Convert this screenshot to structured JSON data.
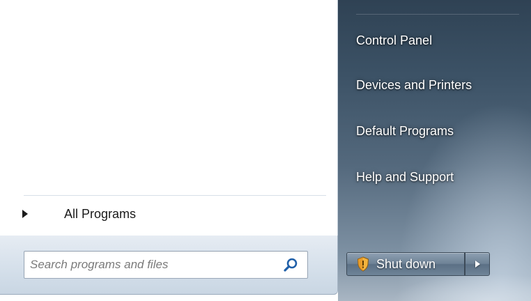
{
  "left_pane": {
    "all_programs_label": "All Programs",
    "search": {
      "placeholder": "Search programs and files",
      "value": ""
    },
    "icons": {
      "arrow": "arrow-right-icon",
      "search": "search-icon"
    }
  },
  "right_pane": {
    "items": [
      {
        "label": "Control Panel"
      },
      {
        "label": "Devices and Printers"
      },
      {
        "label": "Default Programs"
      },
      {
        "label": "Help and Support"
      }
    ],
    "shutdown": {
      "label": "Shut down",
      "icon": "shield-icon",
      "arrow_icon": "chevron-right-icon"
    }
  },
  "colors": {
    "accent_dark": "#2f4254",
    "accent_light": "#a9b6c3",
    "shield": "#f2b33d"
  }
}
